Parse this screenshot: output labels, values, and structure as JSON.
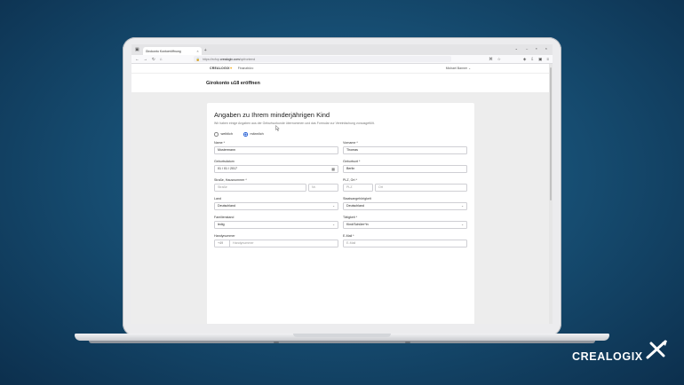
{
  "browser": {
    "tab_title": "Girokonto Kontoeröffnung",
    "url_prefix": "https://ecfop.",
    "url_domain": "crealogix.com",
    "url_path": "/opfrontend"
  },
  "app": {
    "logo_text": "CREALOGIX",
    "menu_label": "Finanzbüro",
    "user_name": "Michael Banner"
  },
  "page": {
    "heading": "Girokonto u18 eröffnen"
  },
  "form": {
    "title": "Angaben zu Ihrem minderjährigen Kind",
    "hint": "Wir haben einige Angaben aus der Geburtsurkunde übernommen und das Formular zur Vereinfachung vorausgefüllt.",
    "gender_options": [
      "weiblich",
      "männlich"
    ],
    "gender_selected": "männlich",
    "fields": {
      "name_label": "Name *",
      "name_value": "Mustermann",
      "firstname_label": "Vorname *",
      "firstname_value": "Thomas",
      "birthdate_label": "Geburtsdatum",
      "birthdate_value": "01 / 01 / 2017",
      "birthplace_label": "Geburtsort *",
      "birthplace_value": "Berlin",
      "street_label": "Straße, Hausnummer *",
      "street_placeholder": "Straße",
      "housenumber_placeholder": "Nr.",
      "zip_label": "PLZ, Ort *",
      "zip_placeholder": "PLZ",
      "city_placeholder": "Ort",
      "country_label": "Land",
      "country_value": "Deutschland",
      "nationality_label": "Staatsangehörigkeit",
      "nationality_value": "Deutschland",
      "marital_label": "Familienstand",
      "marital_value": "ledig",
      "occupation_label": "Tätigkeit *",
      "occupation_value": "Kind/Schüler*in",
      "phone_label": "Handynummer",
      "phone_prefix": "+49",
      "phone_placeholder": "Handynummer",
      "email_label": "E-Mail *",
      "email_placeholder": "E-Mail"
    }
  },
  "brand": {
    "wordmark": "CREALOGIX",
    "accent": "#f0a000"
  }
}
